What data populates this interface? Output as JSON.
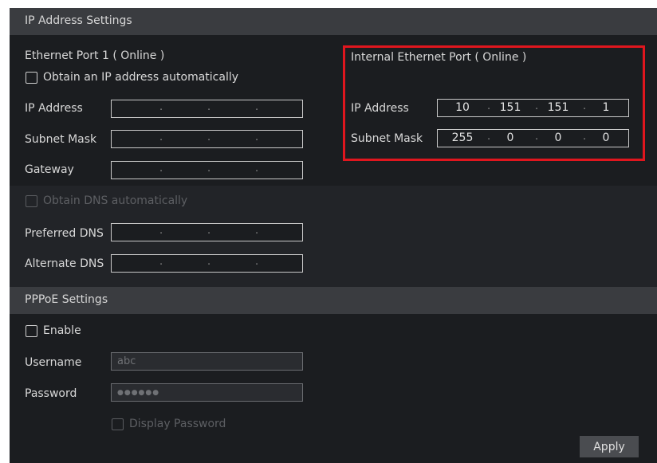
{
  "ip_section": {
    "title": "IP Address Settings",
    "ethernet": {
      "title": "Ethernet Port 1 ( Online )",
      "auto_ip_label": "Obtain an IP address automatically",
      "ip_label": "IP Address",
      "subnet_label": "Subnet Mask",
      "gateway_label": "Gateway",
      "ip_dots": [
        ".",
        ".",
        "."
      ],
      "subnet_dots": [
        ".",
        ".",
        "."
      ],
      "gateway_dots": [
        ".",
        ".",
        "."
      ]
    },
    "internal": {
      "title": "Internal Ethernet Port ( Online )",
      "ip_label": "IP Address",
      "subnet_label": "Subnet Mask",
      "ip": [
        "10",
        "151",
        "151",
        "1"
      ],
      "subnet": [
        "255",
        "0",
        "0",
        "0"
      ],
      "dots": [
        ".",
        ".",
        "."
      ]
    },
    "dns": {
      "auto_label": "Obtain DNS automatically",
      "preferred_label": "Preferred DNS",
      "alternate_label": "Alternate DNS",
      "preferred_dots": [
        ".",
        ".",
        "."
      ],
      "alternate_dots": [
        ".",
        ".",
        "."
      ]
    }
  },
  "pppoe": {
    "title": "PPPoE Settings",
    "enable_label": "Enable",
    "username_label": "Username",
    "username_value": "abc",
    "password_label": "Password",
    "password_value": "●●●●●●",
    "display_password_label": "Display Password"
  },
  "apply_label": "Apply",
  "colors": {
    "highlight": "#e0161e",
    "panel": "#1b1d20",
    "header": "#3a3c40"
  }
}
